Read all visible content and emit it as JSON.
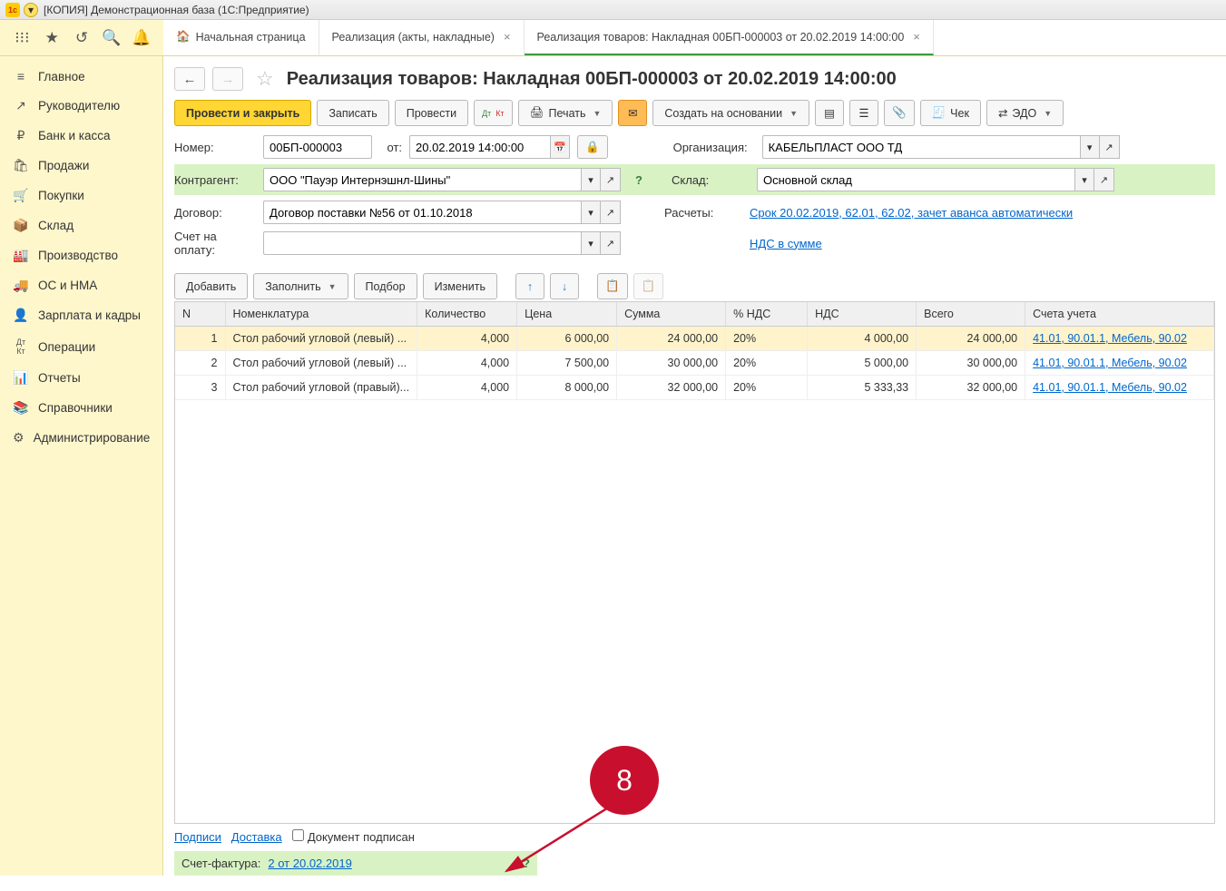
{
  "window": {
    "title": "[КОПИЯ] Демонстрационная база  (1С:Предприятие)"
  },
  "tabs": [
    {
      "label": "Начальная страница",
      "closable": false,
      "icon": "home"
    },
    {
      "label": "Реализация (акты, накладные)",
      "closable": true
    },
    {
      "label": "Реализация товаров: Накладная 00БП-000003 от 20.02.2019 14:00:00",
      "closable": true,
      "active": true
    }
  ],
  "sidebar": [
    {
      "icon": "≡",
      "label": "Главное"
    },
    {
      "icon": "↗",
      "label": "Руководителю"
    },
    {
      "icon": "₽",
      "label": "Банк и касса"
    },
    {
      "icon": "🛍",
      "label": "Продажи"
    },
    {
      "icon": "🛒",
      "label": "Покупки"
    },
    {
      "icon": "📦",
      "label": "Склад"
    },
    {
      "icon": "🏭",
      "label": "Производство"
    },
    {
      "icon": "🚚",
      "label": "ОС и НМА"
    },
    {
      "icon": "👤",
      "label": "Зарплата и кадры"
    },
    {
      "icon": "Дт Кт",
      "label": "Операции"
    },
    {
      "icon": "📊",
      "label": "Отчеты"
    },
    {
      "icon": "📚",
      "label": "Справочники"
    },
    {
      "icon": "⚙",
      "label": "Администрирование"
    }
  ],
  "page": {
    "title": "Реализация товаров: Накладная 00БП-000003 от 20.02.2019 14:00:00"
  },
  "toolbar": {
    "post_close": "Провести и закрыть",
    "save": "Записать",
    "post": "Провести",
    "print": "Печать",
    "create_based": "Создать на основании",
    "cheque": "Чек",
    "edo": "ЭДО"
  },
  "form": {
    "number_label": "Номер:",
    "number_value": "00БП-000003",
    "from_label": "от:",
    "date_value": "20.02.2019 14:00:00",
    "org_label": "Организация:",
    "org_value": "КАБЕЛЬПЛАСТ ООО ТД",
    "contr_label": "Контрагент:",
    "contr_value": "ООО \"Пауэр Интернэшнл-Шины\"",
    "warehouse_label": "Склад:",
    "warehouse_value": "Основной склад",
    "contract_label": "Договор:",
    "contract_value": "Договор поставки №56 от 01.10.2018",
    "calc_label": "Расчеты:",
    "calc_link": "Срок 20.02.2019, 62.01, 62.02, зачет аванса автоматически",
    "invoice_pay_label": "Счет на оплату:",
    "vat_link": "НДС в сумме"
  },
  "table_toolbar": {
    "add": "Добавить",
    "fill": "Заполнить",
    "pick": "Подбор",
    "change": "Изменить"
  },
  "columns": [
    "N",
    "Номенклатура",
    "Количество",
    "Цена",
    "Сумма",
    "% НДС",
    "НДС",
    "Всего",
    "Счета учета"
  ],
  "rows": [
    {
      "n": "1",
      "nom": "Стол рабочий угловой (левый) ...",
      "qty": "4,000",
      "price": "6 000,00",
      "sum": "24 000,00",
      "vat_pct": "20%",
      "vat": "4 000,00",
      "total": "24 000,00",
      "acct": "41.01, 90.01.1, Мебель, 90.02"
    },
    {
      "n": "2",
      "nom": "Стол рабочий угловой (левый) ...",
      "qty": "4,000",
      "price": "7 500,00",
      "sum": "30 000,00",
      "vat_pct": "20%",
      "vat": "5 000,00",
      "total": "30 000,00",
      "acct": "41.01, 90.01.1, Мебель, 90.02"
    },
    {
      "n": "3",
      "nom": "Стол рабочий угловой (правый)...",
      "qty": "4,000",
      "price": "8 000,00",
      "sum": "32 000,00",
      "vat_pct": "20%",
      "vat": "5 333,33",
      "total": "32 000,00",
      "acct": "41.01, 90.01.1, Мебель, 90.02"
    }
  ],
  "footer": {
    "signatures": "Подписи",
    "delivery": "Доставка",
    "signed_label": "Документ подписан",
    "invoice_label": "Счет-фактура:",
    "invoice_link": "2 от 20.02.2019",
    "help": "?"
  },
  "annotation": {
    "number": "8"
  }
}
